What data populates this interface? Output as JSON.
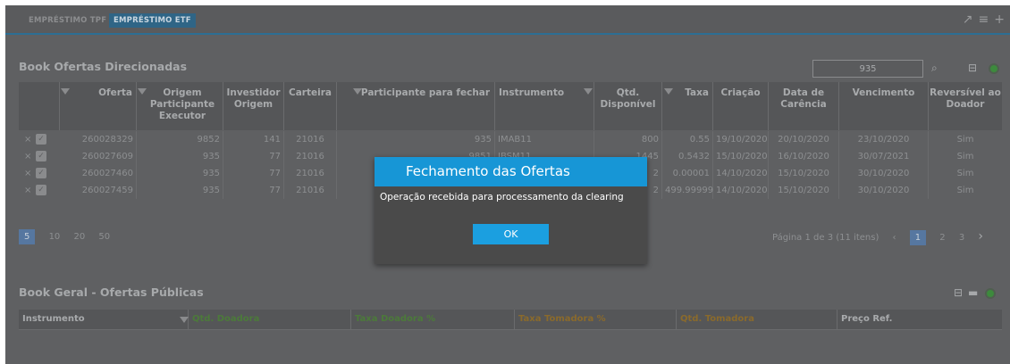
{
  "tabs": [
    {
      "label": "EMPRÉSTIMO TPF"
    },
    {
      "label": "EMPRÉSTIMO ETF"
    }
  ],
  "book_direcionadas": {
    "title": "Book Ofertas Direcionadas",
    "search_value": "935",
    "columns": [
      "Oferta",
      "Origem Participante Executor",
      "Investidor Origem",
      "Carteira",
      "Participante para fechar",
      "Instrumento",
      "Qtd. Disponível",
      "Taxa",
      "Criação",
      "Data de Carência",
      "Vencimento",
      "Reversível ao Doador"
    ],
    "rows": [
      {
        "oferta": "260028329",
        "origem": "9852",
        "investidor": "141",
        "carteira": "21016",
        "participante": "935",
        "instrumento": "IMAB11",
        "qtd": "800",
        "taxa": "0.55",
        "criacao": "19/10/2020",
        "carencia": "20/10/2020",
        "vencimento": "23/10/2020",
        "reversivel": "Sim"
      },
      {
        "oferta": "260027609",
        "origem": "935",
        "investidor": "77",
        "carteira": "21016",
        "participante": "9851",
        "instrumento": "IBSM11",
        "qtd": "1445",
        "taxa": "0.5432",
        "criacao": "15/10/2020",
        "carencia": "16/10/2020",
        "vencimento": "30/07/2021",
        "reversivel": "Sim"
      },
      {
        "oferta": "260027460",
        "origem": "935",
        "investidor": "77",
        "carteira": "21016",
        "participante": "",
        "instrumento": "",
        "qtd": "2",
        "taxa": "0.00001",
        "criacao": "14/10/2020",
        "carencia": "15/10/2020",
        "vencimento": "30/10/2020",
        "reversivel": "Sim"
      },
      {
        "oferta": "260027459",
        "origem": "935",
        "investidor": "77",
        "carteira": "21016",
        "participante": "",
        "instrumento": "",
        "qtd": "2",
        "taxa": "499.99999",
        "criacao": "14/10/2020",
        "carencia": "15/10/2020",
        "vencimento": "30/10/2020",
        "reversivel": "Sim"
      }
    ],
    "page_sizes": [
      "5",
      "10",
      "20",
      "50"
    ],
    "page_info": "Página 1 de 3 (11 itens)",
    "pages": [
      "1",
      "2",
      "3"
    ]
  },
  "book_geral": {
    "title": "Book Geral - Ofertas Públicas",
    "columns": [
      {
        "label": "Instrumento",
        "color": "#a8aaac"
      },
      {
        "label": "Qtd. Doadora",
        "color": "#4c7a3a"
      },
      {
        "label": "Taxa Doadora %",
        "color": "#4c7a3a"
      },
      {
        "label": "Taxa Tomadora %",
        "color": "#8a6a2c"
      },
      {
        "label": "Qtd. Tomadora",
        "color": "#8a6a2c"
      },
      {
        "label": "Preço Ref.",
        "color": "#a8aaac"
      }
    ]
  },
  "modal": {
    "title": "Fechamento das Ofertas",
    "message": "Operação recebida para processamento da clearing",
    "ok_label": "OK"
  },
  "colors": {
    "accent": "#1796d6",
    "overlay_bg": "#5f6062"
  }
}
